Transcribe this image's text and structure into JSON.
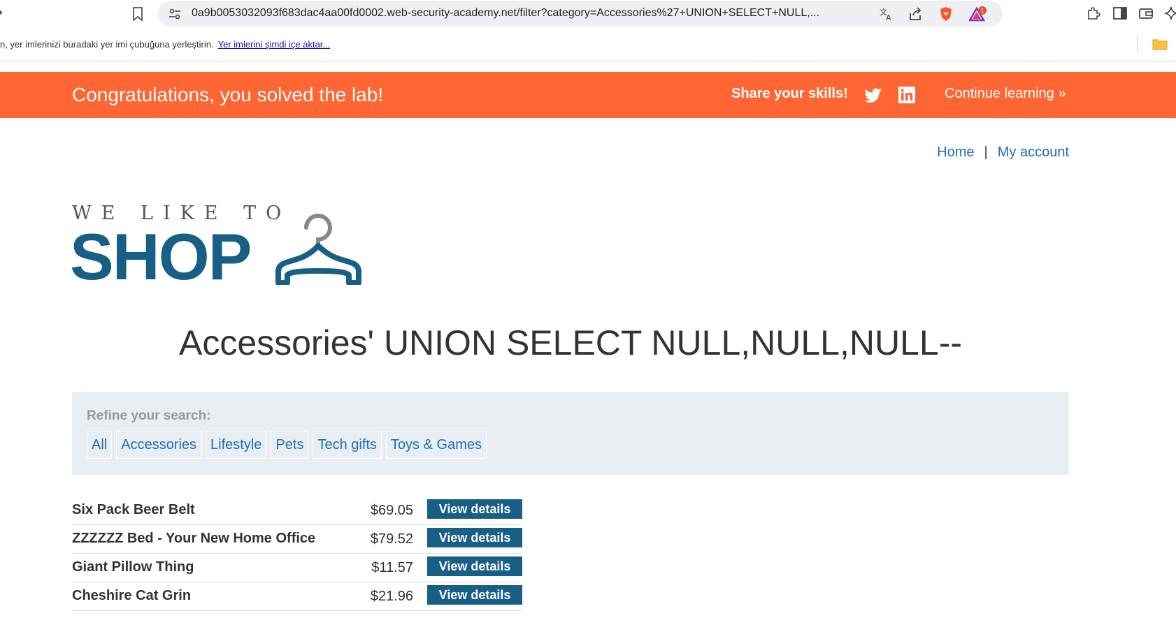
{
  "browser": {
    "url": "0a9b0053032093f683dac4aa00fd0002.web-security-academy.net/filter?category=Accessories%27+UNION+SELECT+NULL,...",
    "notification_count": "1",
    "bookmarks_bar_text": "n, yer imlerinizi buradaki yer imi çubuğuna yerleştirin.",
    "bookmarks_bar_link": "Yer imlerini şimdi içe aktar..."
  },
  "banner": {
    "title": "Congratulations, you solved the lab!",
    "share_text": "Share your skills!",
    "continue_label": "Continue learning",
    "continue_chevron": "»",
    "color": "#ff6633"
  },
  "nav": {
    "home": "Home",
    "separator": "|",
    "my_account": "My account"
  },
  "logo": {
    "tagline": "WE LIKE TO",
    "brand": "SHOP",
    "color": "#185f85"
  },
  "main": {
    "title": "Accessories' UNION SELECT NULL,NULL,NULL--"
  },
  "filter": {
    "heading": "Refine your search:",
    "links": [
      "All",
      "Accessories",
      "Lifestyle",
      "Pets",
      "Tech gifts",
      "Toys & Games"
    ]
  },
  "products": [
    {
      "name": "Six Pack Beer Belt",
      "price": "$69.05",
      "button": "View details"
    },
    {
      "name": "ZZZZZZ Bed - Your New Home Office",
      "price": "$79.52",
      "button": "View details"
    },
    {
      "name": "Giant Pillow Thing",
      "price": "$11.57",
      "button": "View details"
    },
    {
      "name": "Cheshire Cat Grin",
      "price": "$21.96",
      "button": "View details"
    }
  ],
  "icons": {
    "back": "back-arrow-icon",
    "bookmark": "bookmark-icon",
    "site_info": "site-info-icon",
    "translate": "translate-icon",
    "share": "share-icon",
    "brave": "brave-shield-icon",
    "rewards": "brave-rewards-icon",
    "extensions": "extensions-icon",
    "sidebar": "sidebar-icon",
    "wallet": "wallet-icon",
    "twitter": "twitter-icon",
    "linkedin": "linkedin-icon",
    "folder": "folder-icon"
  }
}
